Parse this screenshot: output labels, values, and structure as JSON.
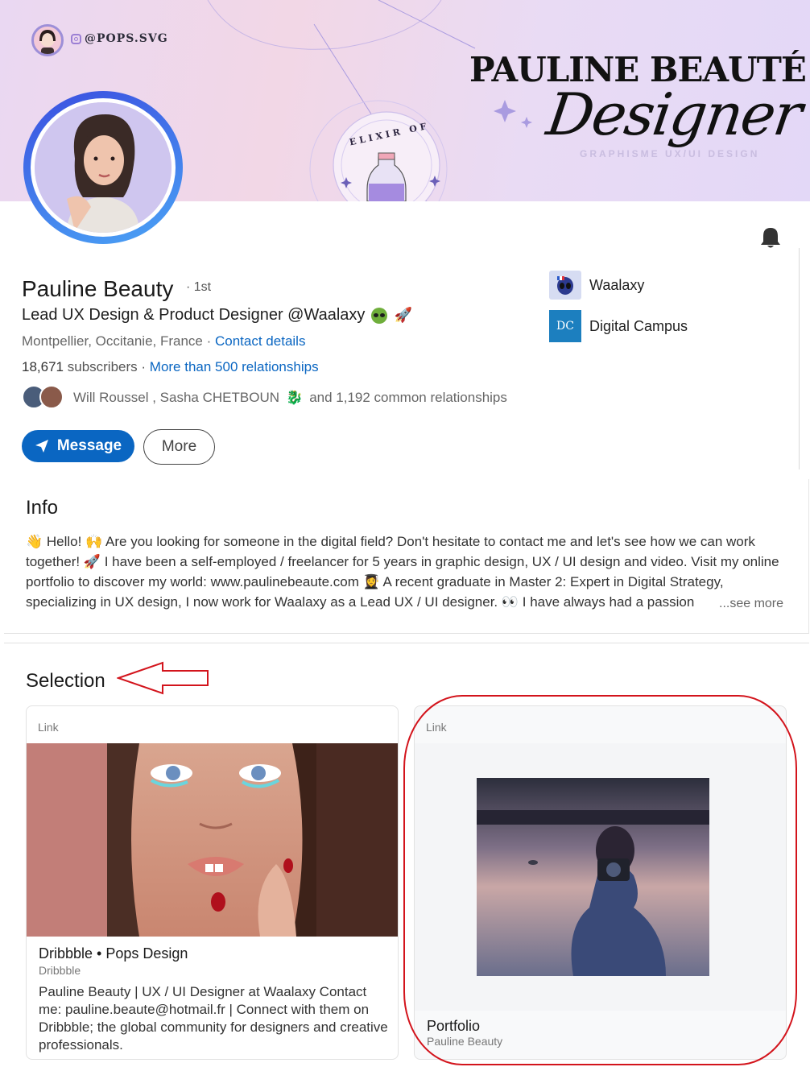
{
  "banner": {
    "instagram_handle": "@POPS.SVG",
    "brand_name": "PAULINE BEAUTÉ",
    "brand_script": "Designer",
    "brand_tags": "GRAPHISME   UX/UI DESIGN",
    "badge_text": "ELIXIR OF"
  },
  "profile": {
    "name": "Pauline Beauty",
    "degree": "· 1st",
    "headline": "Lead UX Design & Product Designer @Waalaxy",
    "location": "Montpellier, Occitanie, France ·",
    "contact_link": "Contact details",
    "subscribers_count": "18,671",
    "subscribers_label": "subscribers",
    "relationships_link": "More than 500  relationships",
    "common_names": "Will Roussel , Sasha CHETBOUN",
    "common_rest": "and 1,192 common relationships"
  },
  "actions": {
    "message_label": "Message",
    "more_label": "More"
  },
  "companies": [
    {
      "name": "Waalaxy",
      "logo_text": ""
    },
    {
      "name": "Digital Campus",
      "logo_text": "DC"
    }
  ],
  "info": {
    "title": "Info",
    "text": "👋 Hello! 🙌 Are you looking for someone in the digital field? Don't hesitate to contact me and let's see how we can work together! 🚀 I have been a self-employed / freelancer for 5 years in graphic design, UX / UI design and video. Visit my online portfolio to discover my world: www.paulinebeaute.com 👩‍🎓 A recent graduate in Master 2: Expert in Digital Strategy, specializing in UX design, I now work for Waalaxy as a Lead UX / UI designer. 👀 I have always had a passion",
    "see_more": "...see more"
  },
  "selection": {
    "title": "Selection",
    "items": [
      {
        "kind": "Link",
        "title": "Dribbble • Pops Design",
        "source": "Dribbble",
        "description": "Pauline Beauty | UX / UI Designer at Waalaxy Contact me: pauline.beaute@hotmail.fr | Connect with them on Dribbble; the global community for designers and creative professionals."
      },
      {
        "kind": "Link",
        "title": "Portfolio",
        "source": "Pauline Beauty"
      }
    ]
  },
  "colors": {
    "accent": "#0a66c2",
    "annotation": "#d3141c"
  }
}
